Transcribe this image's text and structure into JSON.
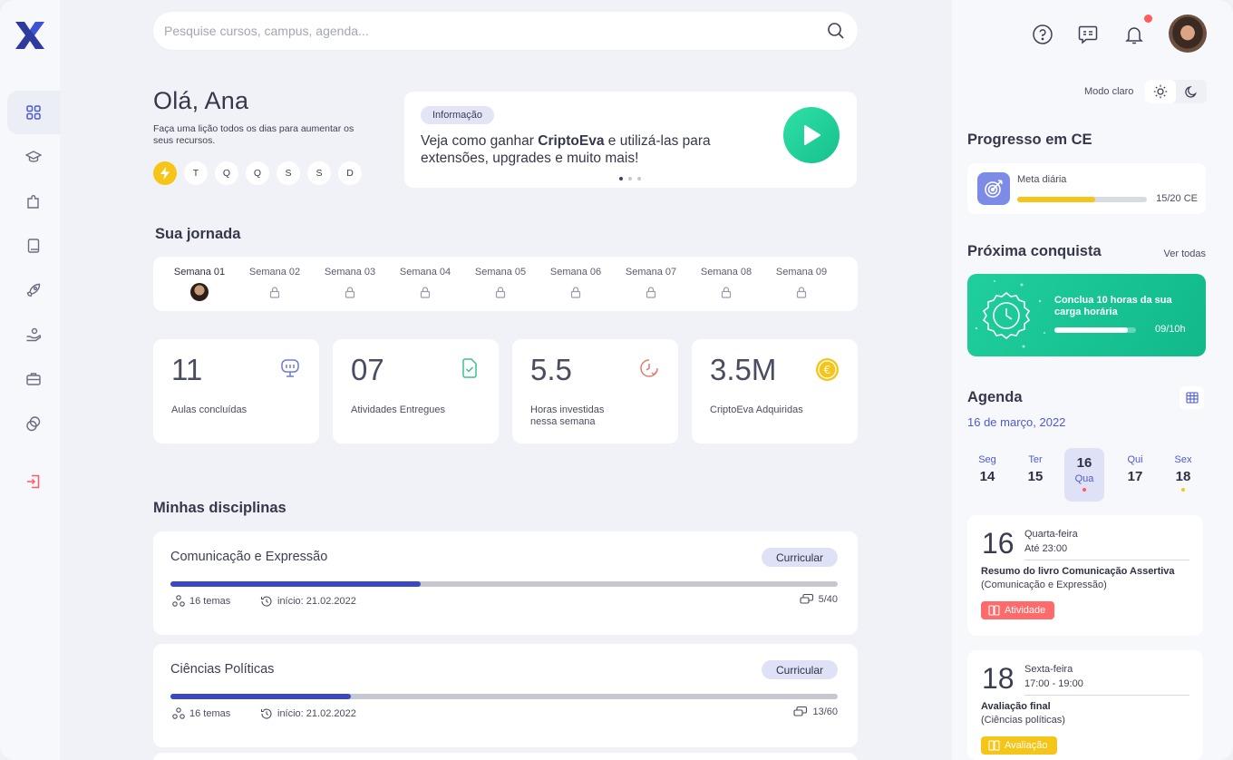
{
  "search": {
    "placeholder": "Pesquise cursos, campus, agenda..."
  },
  "greeting": {
    "title": "Olá, Ana",
    "subtitle": "Faça uma lição todos os dias para aumentar os seus recursos.",
    "days": [
      "T",
      "Q",
      "Q",
      "S",
      "S",
      "D"
    ]
  },
  "info_card": {
    "pill": "Informação",
    "text_pre": "Veja como ganhar ",
    "text_bold": "CriptoEva",
    "text_post": " e utilizá-las para extensões, upgrades e muito mais!"
  },
  "journey": {
    "title": "Sua jornada",
    "weeks": [
      "Semana 01",
      "Semana 02",
      "Semana 03",
      "Semana 04",
      "Semana 05",
      "Semana 06",
      "Semana 07",
      "Semana 08",
      "Semana 09"
    ]
  },
  "stats": [
    {
      "value": "11",
      "label": "Aulas concluídas",
      "icon": "monitor-icon",
      "color": "#6f7bd8"
    },
    {
      "value": "07",
      "label": "Atividades Entregues",
      "icon": "file-check-icon",
      "color": "#3bc08f"
    },
    {
      "value": "5.5",
      "label": "Horas investidas nessa semana",
      "icon": "clock-check-icon",
      "color": "#e27a6f"
    },
    {
      "value": "3.5M",
      "label": "CriptoEva Adquiridas",
      "icon": "euro-coin-icon",
      "color": "#f5c518"
    }
  ],
  "courses": {
    "title": "Minhas disciplinas",
    "items": [
      {
        "name": "Comunicação e Expressão",
        "tag": "Curricular",
        "progress": 0.375,
        "topics": "16 temas",
        "start": "início: 21.02.2022",
        "count": "5/40"
      },
      {
        "name": "Ciências Políticas",
        "tag": "Curricular",
        "progress": 0.27,
        "topics": "16 temas",
        "start": "início: 21.02.2022",
        "count": "13/60"
      }
    ]
  },
  "right": {
    "mode_label": "Modo claro",
    "progress_title": "Progresso em CE",
    "goal_label": "Meta diária",
    "goal_value": "15/20 CE",
    "goal_progress": 0.6,
    "next_title": "Próxima conquista",
    "see_all": "Ver todas",
    "achievement_text": "Conclua 10 horas da sua carga horária",
    "achievement_value": "09/10h",
    "achievement_progress": 0.9,
    "agenda_title": "Agenda",
    "agenda_date": "16 de março, 2022",
    "calendar_days": [
      {
        "name": "Seg",
        "num": "14"
      },
      {
        "name": "Ter",
        "num": "15"
      },
      {
        "name": "Qua",
        "num": "16"
      },
      {
        "name": "Qui",
        "num": "17"
      },
      {
        "name": "Sex",
        "num": "18"
      }
    ],
    "events": [
      {
        "day": "16",
        "weekday": "Quarta-feira",
        "time": "Até 23:00",
        "title": "Resumo do livro Comunicação Assertiva",
        "subject": "(Comunicação e Expressão)",
        "tag": "Atividade"
      },
      {
        "day": "18",
        "weekday": "Sexta-feira",
        "time": "17:00 - 19:00",
        "title": "Avaliação final",
        "subject": "(Ciências políticas)",
        "tag": "Avaliação"
      }
    ]
  },
  "colors": {
    "accent": "#3a48c4",
    "green": "#1fcf9c",
    "yellow": "#f5c518",
    "red": "#ff6b6b"
  }
}
